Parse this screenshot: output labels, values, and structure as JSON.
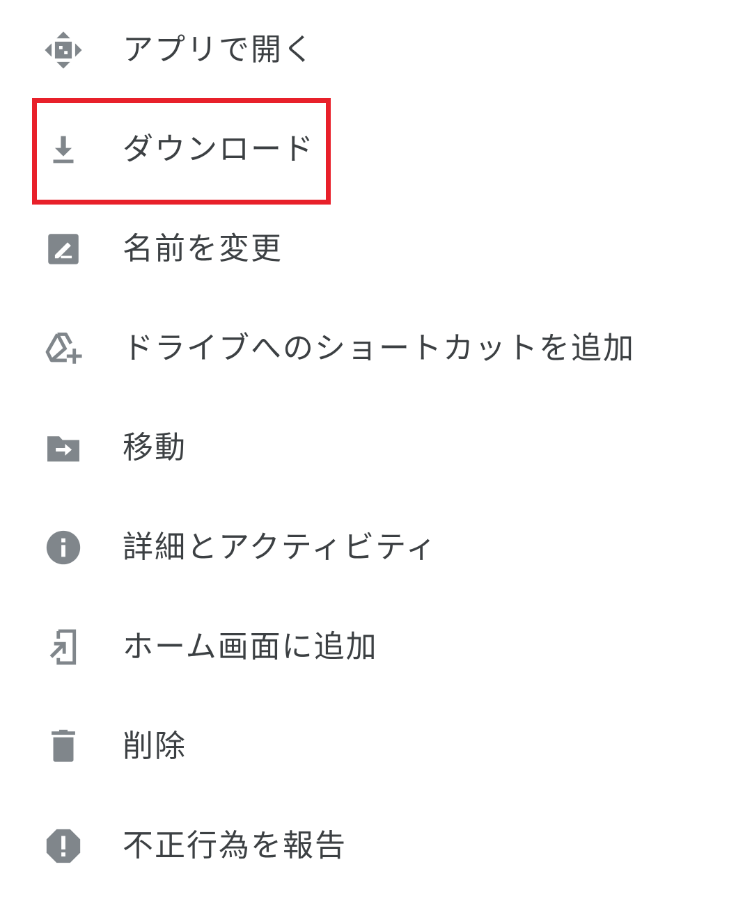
{
  "menu": {
    "items": [
      {
        "label": "アプリで開く",
        "icon": "open-with-icon"
      },
      {
        "label": "ダウンロード",
        "icon": "download-icon"
      },
      {
        "label": "名前を変更",
        "icon": "rename-icon"
      },
      {
        "label": "ドライブへのショートカットを追加",
        "icon": "add-shortcut-icon"
      },
      {
        "label": "移動",
        "icon": "move-folder-icon"
      },
      {
        "label": "詳細とアクティビティ",
        "icon": "info-icon"
      },
      {
        "label": "ホーム画面に追加",
        "icon": "add-to-home-icon"
      },
      {
        "label": "削除",
        "icon": "trash-icon"
      },
      {
        "label": "不正行為を報告",
        "icon": "report-icon"
      }
    ],
    "highlighted_item": "ダウンロード"
  },
  "colors": {
    "icon": "#80868b",
    "text": "#3c4043",
    "highlight_border": "#e8202a",
    "background": "#ffffff"
  }
}
